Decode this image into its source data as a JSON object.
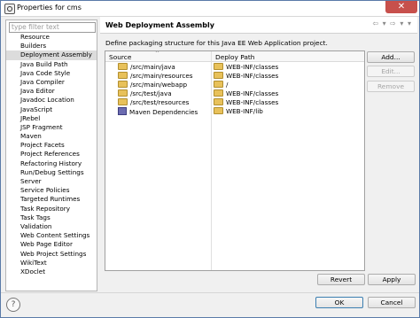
{
  "window": {
    "title": "Properties for cms",
    "close": "✕"
  },
  "filter": {
    "placeholder": "type filter text"
  },
  "nav": {
    "items": [
      "Resource",
      "Builders",
      "Deployment Assembly",
      "Java Build Path",
      "Java Code Style",
      "Java Compiler",
      "Java Editor",
      "Javadoc Location",
      "JavaScript",
      "JRebel",
      "JSP Fragment",
      "Maven",
      "Project Facets",
      "Project References",
      "Refactoring History",
      "Run/Debug Settings",
      "Server",
      "Service Policies",
      "Targeted Runtimes",
      "Task Repository",
      "Task Tags",
      "Validation",
      "Web Content Settings",
      "Web Page Editor",
      "Web Project Settings",
      "WikiText",
      "XDoclet"
    ],
    "selected": "Deployment Assembly"
  },
  "page": {
    "title": "Web Deployment Assembly",
    "arrows": "⇦ ▾ ⇨ ▾ ▾",
    "description": "Define packaging structure for this Java EE Web Application project."
  },
  "table": {
    "columns": [
      "Source",
      "Deploy Path"
    ],
    "sort_indicator": "^",
    "rows": [
      {
        "source": "/src/main/java",
        "deploy": "WEB-INF/classes",
        "icon": "folder-icon"
      },
      {
        "source": "/src/main/resources",
        "deploy": "WEB-INF/classes",
        "icon": "folder-icon"
      },
      {
        "source": "/src/main/webapp",
        "deploy": "/",
        "icon": "folder-icon"
      },
      {
        "source": "/src/test/java",
        "deploy": "WEB-INF/classes",
        "icon": "folder-icon"
      },
      {
        "source": "/src/test/resources",
        "deploy": "WEB-INF/classes",
        "icon": "folder-icon"
      },
      {
        "source": "Maven Dependencies",
        "deploy": "WEB-INF/lib",
        "icon": "library-icon"
      }
    ]
  },
  "buttons": {
    "add": "Add...",
    "edit": "Edit...",
    "remove": "Remove",
    "revert": "Revert",
    "apply": "Apply",
    "ok": "OK",
    "cancel": "Cancel"
  },
  "help": {
    "glyph": "?"
  }
}
